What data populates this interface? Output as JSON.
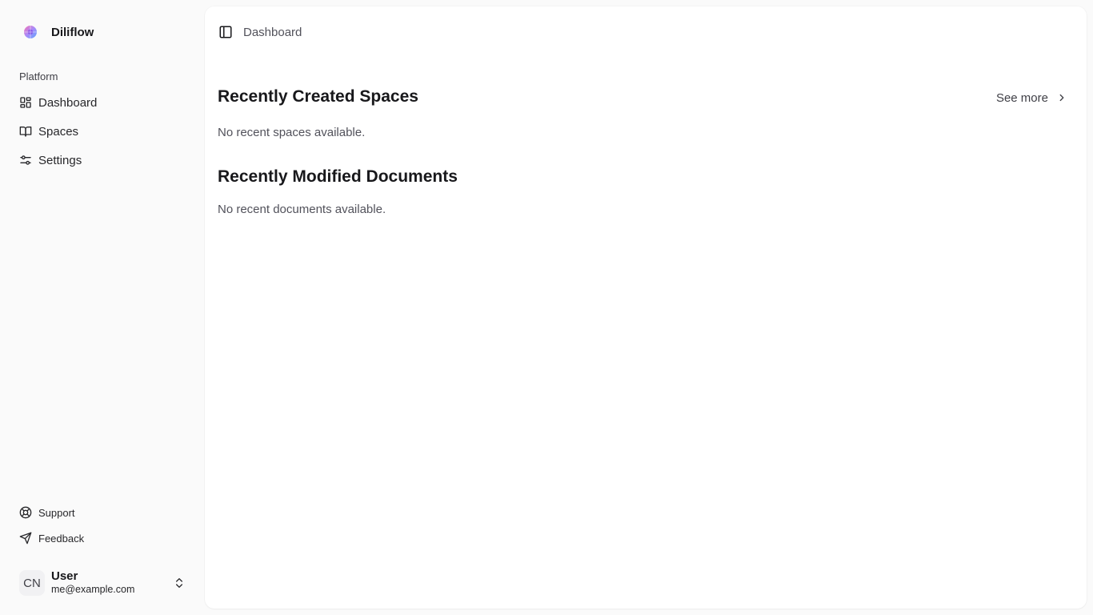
{
  "app": {
    "name": "Diliflow",
    "logo_icon": "diliflow-logo-icon"
  },
  "sidebar": {
    "group_label": "Platform",
    "nav_items": [
      {
        "label": "Dashboard",
        "icon": "layout-dashboard-icon"
      },
      {
        "label": "Spaces",
        "icon": "book-open-icon"
      },
      {
        "label": "Settings",
        "icon": "sliders-icon"
      }
    ],
    "secondary_items": [
      {
        "label": "Support",
        "icon": "lifebuoy-icon"
      },
      {
        "label": "Feedback",
        "icon": "send-icon"
      }
    ],
    "user": {
      "initials": "CN",
      "name": "User",
      "email": "me@example.com",
      "chevron_icon": "chevrons-up-down-icon"
    }
  },
  "header": {
    "toggle_icon": "panel-left-icon",
    "breadcrumb": "Dashboard"
  },
  "main": {
    "recent_spaces": {
      "title": "Recently Created Spaces",
      "see_more": "See more",
      "empty_text": "No recent spaces available."
    },
    "recent_documents": {
      "title": "Recently Modified Documents",
      "empty_text": "No recent documents available."
    }
  },
  "colors": {
    "background": "#fafafa",
    "panel": "#ffffff",
    "text": "#18181b",
    "muted_text": "#52525b"
  }
}
